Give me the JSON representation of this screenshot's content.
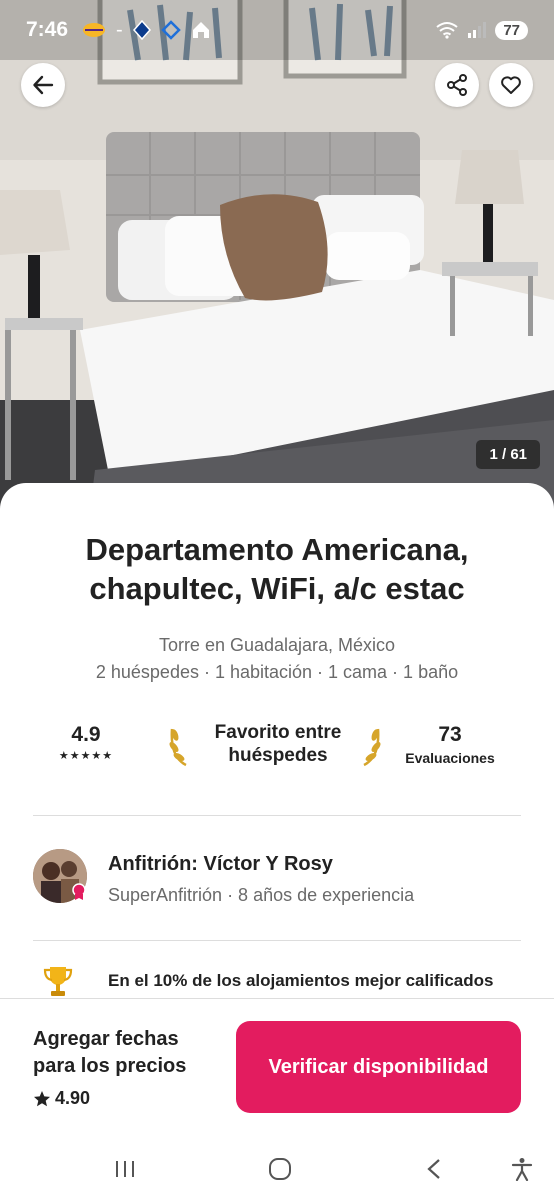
{
  "status_bar": {
    "time": "7:46",
    "separator": "-",
    "battery": "77",
    "left_icons": [
      "lakers-logo-icon",
      "mavericks-logo-icon",
      "binance-logo-icon",
      "home-app-icon"
    ],
    "right_icons": [
      "wifi-icon",
      "signal-icon",
      "battery-icon"
    ]
  },
  "gallery": {
    "counter": "1 / 61"
  },
  "listing": {
    "title": "Departamento Americana, chapultec, WiFi, a/c estac",
    "subtitle": "Torre en Guadalajara, México",
    "details": "2 huéspedes · 1 habitación · 1 cama · 1 baño"
  },
  "stats": {
    "rating": "4.9",
    "stars": "★★★★★",
    "favorite_label": "Favorito entre huéspedes",
    "reviews_count": "73",
    "reviews_label": "Evaluaciones"
  },
  "host": {
    "name": "Anfitrión: Víctor Y Rosy",
    "meta": "SuperAnfitrión · 8  años de experiencia"
  },
  "highlight": {
    "text": "En el 10% de los alojamientos mejor calificados"
  },
  "footer": {
    "prompt": "Agregar fechas para los precios",
    "rating": "4.90",
    "cta_label": "Verificar disponibilidad"
  },
  "colors": {
    "brand": "#e31c5f",
    "text_primary": "#222222",
    "text_secondary": "#6a6a6a",
    "laurel_gold": "#d6a52a"
  }
}
